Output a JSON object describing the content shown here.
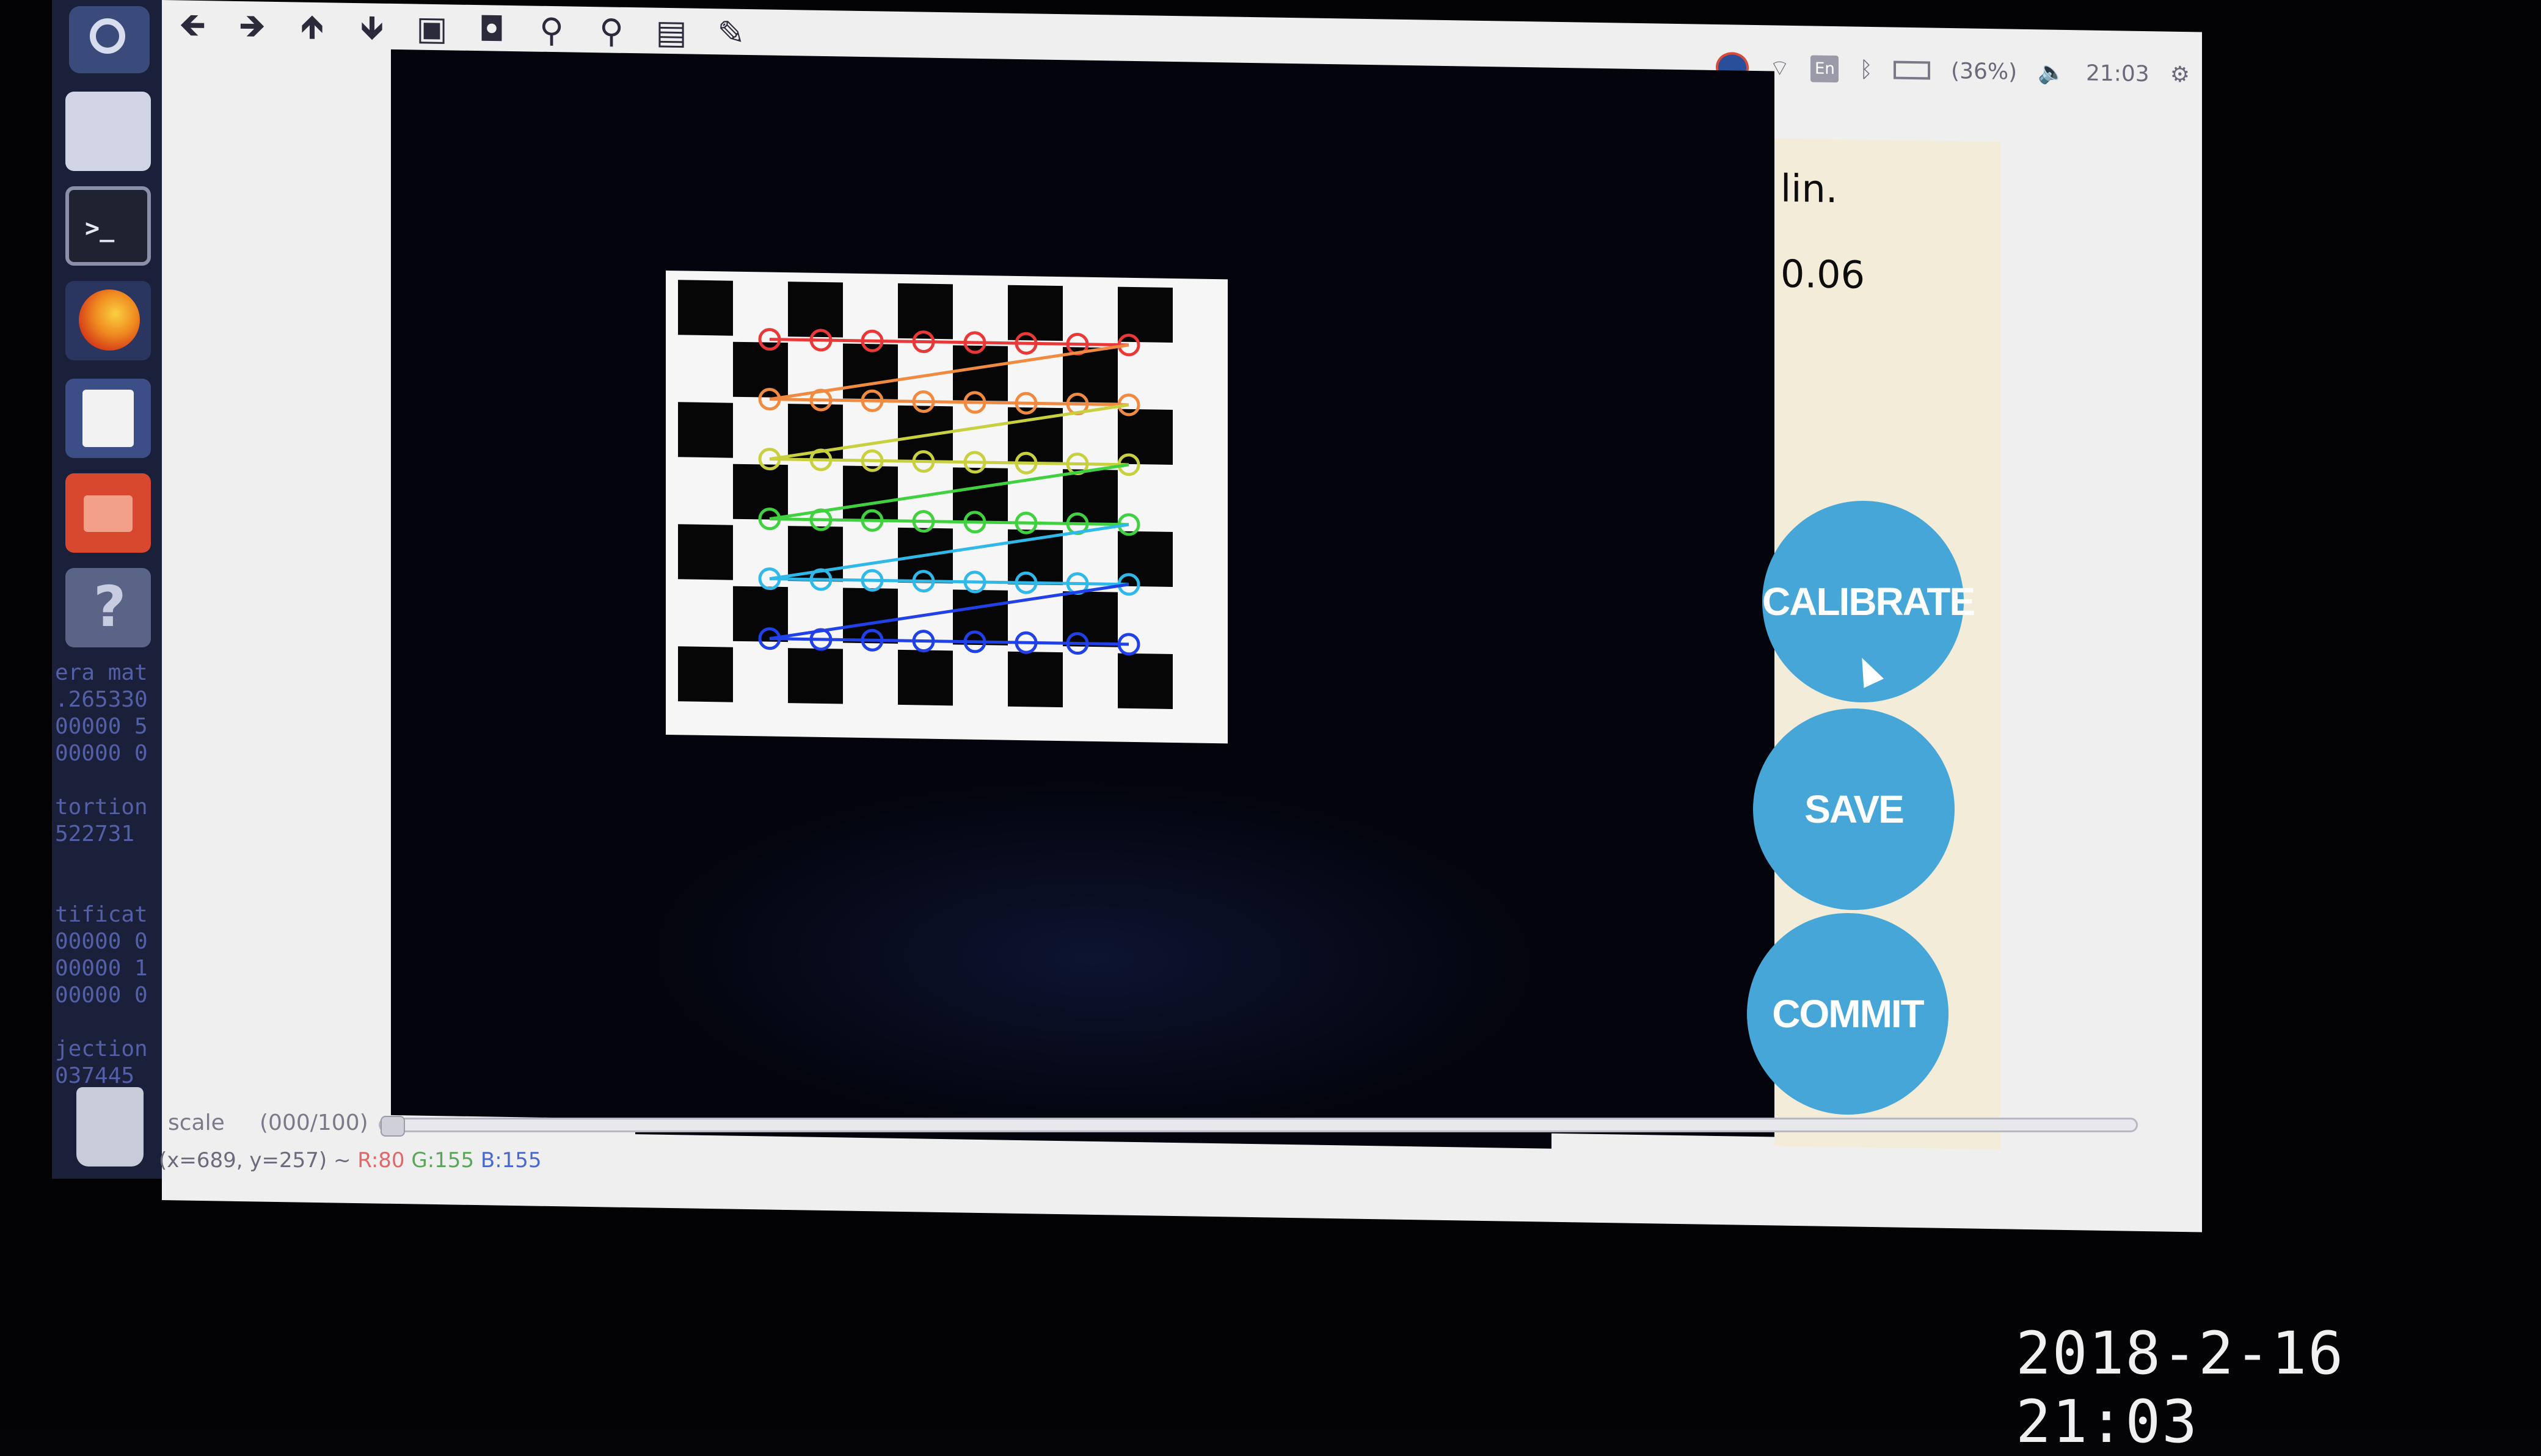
{
  "launcher": {
    "terminal_prompt": ">_",
    "help_glyph": "?",
    "terminal_output": [
      "era mat",
      ".265330",
      "00000 5",
      "00000 0",
      "",
      "tortion",
      "522731",
      "",
      "",
      "tificat",
      "00000 0",
      "00000 1",
      "00000 0",
      "",
      "jection",
      "037445"
    ]
  },
  "toolbar": {
    "icons": [
      "arrow-left-icon",
      "arrow-right-icon",
      "arrow-up-icon",
      "arrow-down-icon",
      "monitor-icon",
      "properties-icon",
      "zoom-in-icon",
      "zoom-out-icon",
      "save-icon",
      "brush-icon"
    ]
  },
  "tray": {
    "keyboard": "En",
    "battery": "(36%)",
    "time": "21:03"
  },
  "panel": {
    "label_line1": "lin.",
    "label_value": "0.06",
    "calibrate": "CALIBRATE",
    "save": "SAVE",
    "commit": "COMMIT"
  },
  "trackbar": {
    "name": "scale",
    "value": "(000/100)",
    "position": 0.0
  },
  "status": {
    "coords": "(x=689, y=257) ~ ",
    "r": "R:80",
    "g": "G:155",
    "b": "B:155"
  },
  "chessboard": {
    "row_colors": [
      "#e83838",
      "#f08a40",
      "#c8d040",
      "#40d040",
      "#30b8e8",
      "#2040e8"
    ],
    "corners_per_row": 8,
    "rows": 6
  },
  "timestamp": "2018-2-16 21:03"
}
